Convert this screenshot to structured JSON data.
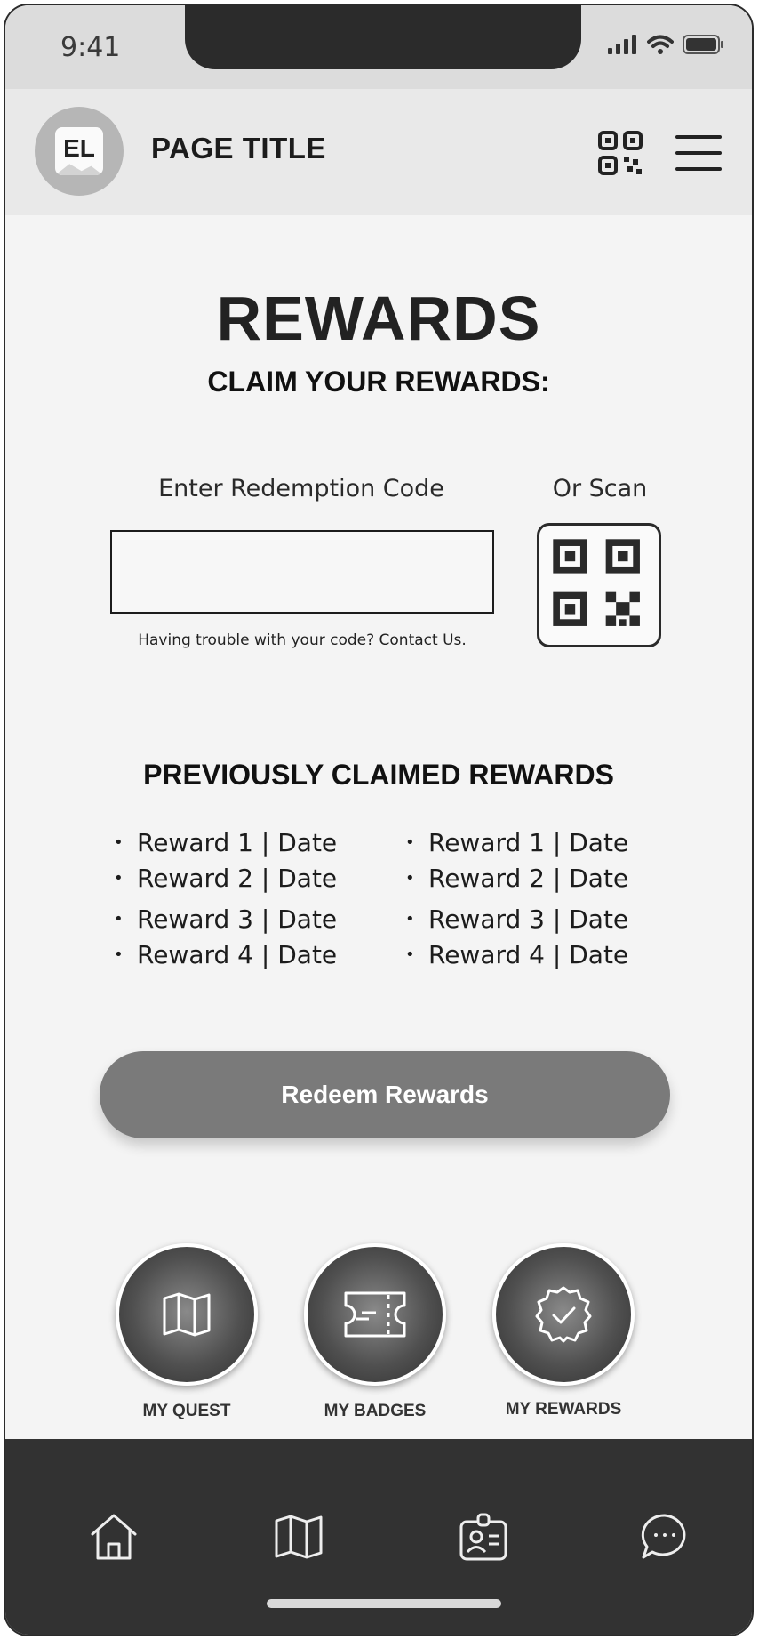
{
  "status": {
    "time": "9:41"
  },
  "header": {
    "avatar_text": "EL",
    "title": "PAGE TITLE"
  },
  "main": {
    "heading": "REWARDS",
    "subheading": "CLAIM YOUR REWARDS:",
    "code_label": "Enter Redemption Code",
    "scan_label": "Or Scan",
    "code_value": "",
    "code_placeholder": "",
    "help_text": "Having trouble with your code? Contact Us."
  },
  "claimed": {
    "title": "PREVIOUSLY CLAIMED REWARDS",
    "left": [
      "Reward 1 | Date",
      "Reward 2 | Date",
      "Reward 3 | Date",
      "Reward 4 | Date"
    ],
    "right": [
      "Reward 1 | Date",
      "Reward 2 | Date",
      "Reward 3 | Date",
      "Reward 4 | Date"
    ]
  },
  "redeem_label": "Redeem Rewards",
  "shortcuts": [
    {
      "label": "MY QUEST",
      "icon": "map-icon"
    },
    {
      "label": "MY BADGES",
      "icon": "ticket-icon"
    },
    {
      "label": "MY REWARDS",
      "icon": "badge-check-icon"
    }
  ],
  "tabbar": [
    "home-icon",
    "map-icon",
    "id-card-icon",
    "chat-icon"
  ],
  "colors": {
    "button": "#7a7a7a",
    "tabbar": "#323232",
    "header": "#e9e9e9",
    "status_bar": "#dcdcdc"
  }
}
